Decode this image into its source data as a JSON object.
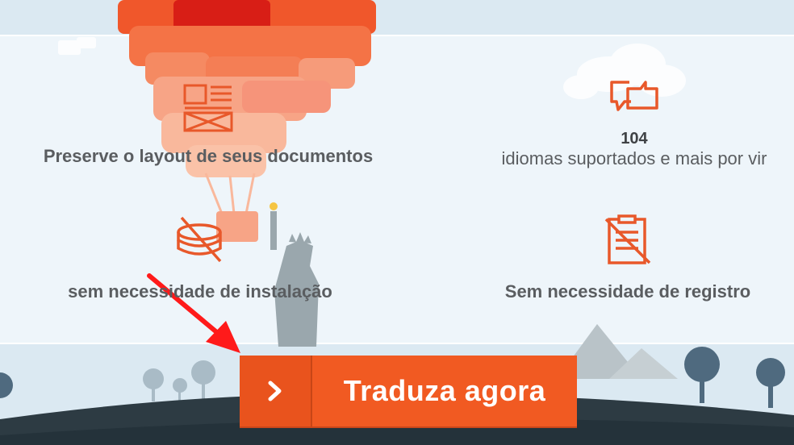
{
  "features": {
    "layout": {
      "label": "Preserve o layout de seus documentos",
      "icon": "document-layout-icon"
    },
    "languages": {
      "count": "104",
      "label": "idiomas suportados e mais por vir",
      "icon": "translate-icon"
    },
    "install": {
      "label": "sem necessidade de instalação",
      "icon": "no-install-icon"
    },
    "register": {
      "label": "Sem necessidade de registro",
      "icon": "no-register-icon"
    }
  },
  "cta": {
    "label": "Traduza agora",
    "icon": "chevron-right-icon"
  },
  "colors": {
    "accent": "#f15a22",
    "icon": "#e8582a",
    "text": "#5a5d60",
    "annotation_arrow": "#ff1a1a"
  }
}
